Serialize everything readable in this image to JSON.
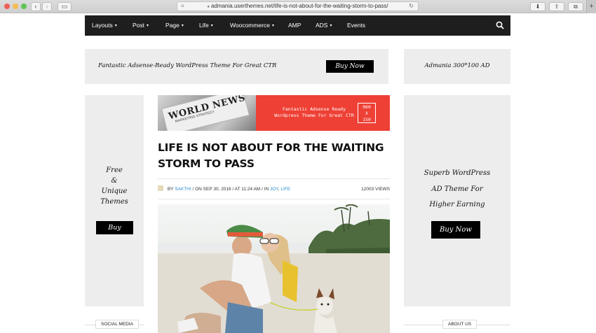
{
  "browser": {
    "url": "admania.userthemes.net/life-is-not-about-for-the-waiting-storm-to-pass/",
    "back_icon": "chevron-left-icon",
    "forward_icon": "chevron-right-icon",
    "back_glyph": "‹",
    "forward_glyph": "›",
    "sidebar_glyph": "▭",
    "lock_glyph": "🔒",
    "reader_glyph": "≡",
    "reload_glyph": "↻",
    "download_glyph": "⬇",
    "share_glyph": "⇪",
    "tabs_glyph": "⧉",
    "plus_glyph": "+"
  },
  "nav": {
    "items": [
      {
        "label": "Layouts",
        "has_caret": true
      },
      {
        "label": "Post",
        "has_caret": true
      },
      {
        "label": "Page",
        "has_caret": true
      },
      {
        "label": "Life",
        "has_caret": true
      },
      {
        "label": "Woocommerce",
        "has_caret": true
      },
      {
        "label": "AMP",
        "has_caret": false
      },
      {
        "label": "ADS",
        "has_caret": true
      },
      {
        "label": "Events",
        "has_caret": false
      }
    ],
    "caret_glyph": "▾"
  },
  "top_ad": {
    "text": "Fantastic Adsense-Ready WordPress Theme For Great CTR",
    "button": "Buy Now"
  },
  "right_top_ad": {
    "text": "Admania 300*100 AD"
  },
  "left_ad": {
    "line1": "Free",
    "line2": "&",
    "line3": "Unique",
    "line4": "Themes",
    "button": "Buy"
  },
  "right_ad": {
    "line1": "Superb WordPress",
    "line2": "AD Theme For",
    "line3": "Higher Earning",
    "button": "Buy Now"
  },
  "banner": {
    "paper_title": "WORLD NEWS",
    "paper_sub": "MARKETING STRATEGY",
    "line1": "Fantastic Adsense Ready",
    "line2": "Wordpress Theme For Great CTR",
    "size1": "960",
    "size2": "X",
    "size3": "150"
  },
  "post": {
    "title": "LIFE IS NOT ABOUT FOR THE WAITING STORM TO PASS",
    "by": "BY",
    "author": "SAKTHI",
    "on": "/ ON SEP 30, 2016",
    "at": "/ AT 11:24 AM",
    "in": "/ IN",
    "cat1": "JOY",
    "sep": ",",
    "cat2": "LIFE",
    "views": "12003 VIEWS"
  },
  "footer_labels": {
    "social": "SOCIAL MEDIA",
    "about": "ABOUT US"
  },
  "colors": {
    "nav_bg": "#1e1e1e",
    "banner_red": "#ee4035",
    "link_blue": "#2a8fd0",
    "ad_grey": "#ededed"
  }
}
